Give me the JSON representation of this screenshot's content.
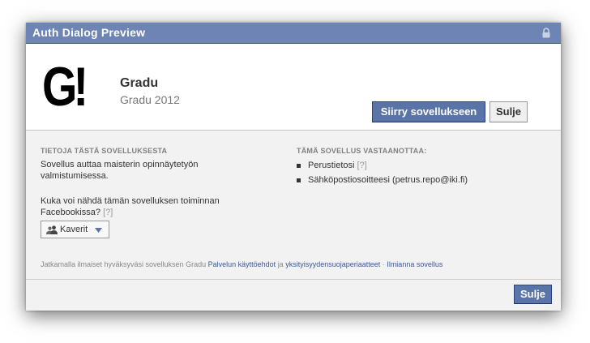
{
  "dialog": {
    "title": "Auth Dialog Preview"
  },
  "app": {
    "logo_text": "G!",
    "name": "Gradu",
    "subtitle": "Gradu 2012"
  },
  "buttons": {
    "go_to_app": "Siirry sovellukseen",
    "close": "Sulje",
    "close_bottom": "Sulje"
  },
  "about": {
    "heading": "TIETOJA TÄSTÄ SOVELLUKSESTA",
    "description": "Sovellus auttaa maisterin opinnäytetyön valmistumisessa.",
    "visibility_question": "Kuka voi nähdä tämän sovelluksen toiminnan Facebookissa?",
    "help_marker": "[?]",
    "audience_value": "Kaverit"
  },
  "permissions": {
    "heading": "TÄMÄ SOVELLUS VASTAANOTTAA:",
    "items": [
      {
        "label": "Perustietosi",
        "help": "[?]"
      },
      {
        "label": "Sähköpostiosoitteesi (petrus.repo@iki.fi)",
        "help": ""
      }
    ]
  },
  "footer": {
    "prefix": "Jatkamalla ilmaiset hyväksyväsi sovelluksen Gradu",
    "terms_link": "Palvelun käyttöehdot",
    "and": "ja",
    "privacy_link": "yksityisyydensuojaperiaatteet",
    "separator": "·",
    "report_link": "Ilmianna sovellus"
  },
  "colors": {
    "titlebar": "#6d84b4",
    "primary_button": "#5b74a8",
    "link": "#3b5998"
  }
}
